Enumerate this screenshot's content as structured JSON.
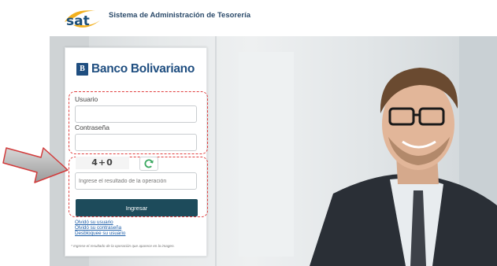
{
  "header": {
    "logo_text": "sat",
    "title": "Sistema de Administración de Tesorería"
  },
  "login": {
    "bank_mark": "B",
    "bank_name": "Banco Bolivariano",
    "username_label": "Usuario",
    "username_value": "",
    "password_label": "Contraseña",
    "password_value": "",
    "captcha_text": "4+0",
    "captcha_placeholder": "Ingrese el resultado de la operación",
    "submit_label": "Ingresar",
    "links": [
      "Olvidó su usuario",
      "Olvidó su contraseña",
      "Desbloquee su usuario"
    ],
    "footnote": "* Ingrese el resultado de la operación que aparece en la imagen."
  },
  "icons": {
    "refresh": "refresh-icon",
    "annotation_arrow": "arrow-right-icon"
  },
  "colors": {
    "brand_blue": "#1f4e80",
    "button": "#1d4b5b",
    "annotation_red": "#e04040",
    "sat_orange": "#f2b01e"
  }
}
